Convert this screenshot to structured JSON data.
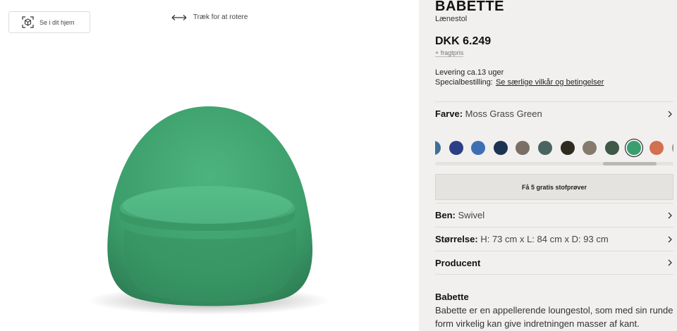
{
  "viewer": {
    "ar_label": "Se i dit hjem",
    "rotate_hint": "Træk for at rotere"
  },
  "product": {
    "name": "BABETTE",
    "type": "Lænestol",
    "price": "DKK 6.249",
    "freight": "+ fragtpris",
    "delivery": "Levering ca.13 uger",
    "special_label": "Specialbestilling:",
    "special_link": "Se særlige vilkår og betingelser"
  },
  "options": {
    "color_label": "Farve:",
    "color_value": "Moss Grass Green",
    "swatches": [
      {
        "color": "#3f6f97",
        "name": "partial-blue"
      },
      {
        "color": "#2b3f86",
        "name": "navy"
      },
      {
        "color": "#3e6fb5",
        "name": "blue"
      },
      {
        "color": "#1c3352",
        "name": "dark-navy"
      },
      {
        "color": "#7a6f66",
        "name": "taupe"
      },
      {
        "color": "#4a6461",
        "name": "slate-green"
      },
      {
        "color": "#302b20",
        "name": "dark-olive"
      },
      {
        "color": "#857a6c",
        "name": "grey-brown"
      },
      {
        "color": "#3f5848",
        "name": "forest"
      },
      {
        "color": "#3a9e6e",
        "name": "moss-grass-green",
        "selected": true
      },
      {
        "color": "#d2704f",
        "name": "terracotta"
      },
      {
        "color": "#9a958c",
        "name": "partial-grey"
      }
    ],
    "samples_button": "Få 5 gratis stofprøver",
    "legs_label": "Ben:",
    "legs_value": "Swivel",
    "size_label": "Størrelse:",
    "size_value": "H: 73 cm x L: 84 cm x D: 93 cm",
    "producer_label": "Producent"
  },
  "description": {
    "title": "Babette",
    "text": "Babette er en appellerende loungestol, som med sin runde form virkelig kan give indretningen masser af kant."
  },
  "colors": {
    "chair": "#3fa36f",
    "panel_bg": "#f1f0ee"
  }
}
